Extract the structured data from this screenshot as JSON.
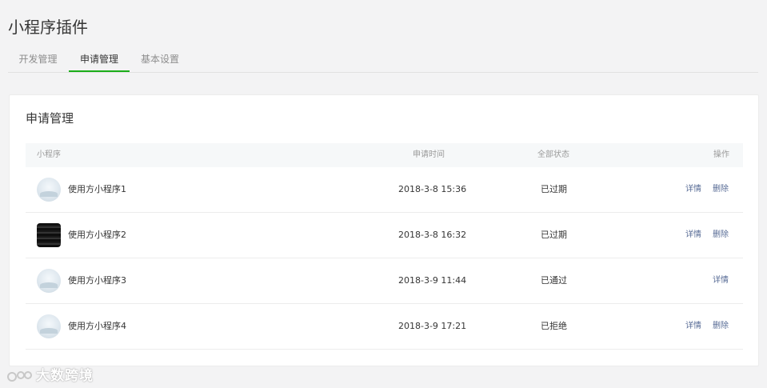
{
  "page": {
    "title": "小程序插件"
  },
  "tabs": [
    {
      "label": "开发管理"
    },
    {
      "label": "申请管理"
    },
    {
      "label": "基本设置"
    }
  ],
  "card": {
    "title": "申请管理",
    "columns": {
      "app": "小程序",
      "time": "申请时间",
      "status": "全部状态",
      "actions": "操作"
    },
    "rows": [
      {
        "name": "使用方小程序1",
        "time": "2018-3-8 15:36",
        "status": "已过期",
        "detail": "详情",
        "delete": "删除"
      },
      {
        "name": "使用方小程序2",
        "time": "2018-3-8 16:32",
        "status": "已过期",
        "detail": "详情",
        "delete": "删除"
      },
      {
        "name": "使用方小程序3",
        "time": "2018-3-9 11:44",
        "status": "已通过",
        "detail": "详情"
      },
      {
        "name": "使用方小程序4",
        "time": "2018-3-9 17:21",
        "status": "已拒绝",
        "detail": "详情",
        "delete": "删除"
      }
    ]
  },
  "watermark": {
    "text": "大数跨境"
  },
  "colors": {
    "accent": "#1aad19",
    "link": "#576b95",
    "background": "#f3f3f4"
  }
}
